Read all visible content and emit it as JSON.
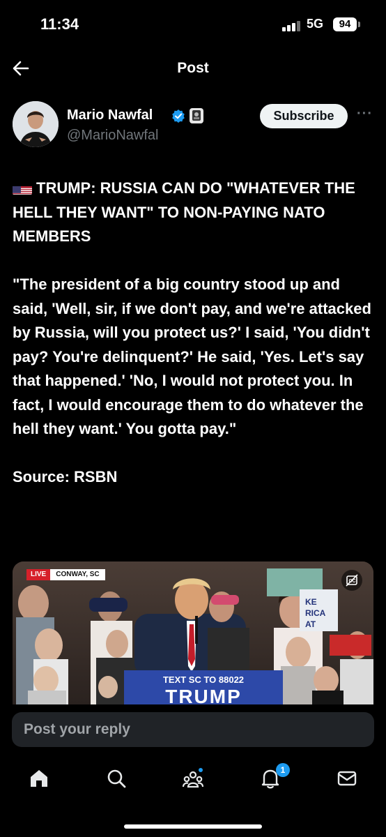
{
  "status_bar": {
    "time": "11:34",
    "network": "5G",
    "battery": "94"
  },
  "header": {
    "title": "Post"
  },
  "author": {
    "name": "Mario Nawfal",
    "handle": "@MarioNawfal"
  },
  "actions": {
    "subscribe_label": "Subscribe",
    "more_label": "···"
  },
  "post": {
    "headline": "TRUMP: RUSSIA CAN DO \"WHATEVER THE HELL THEY WANT\" TO NON-PAYING NATO MEMBERS",
    "quote": "\"The president of a big country stood up and said, 'Well, sir, if we don't pay, and we're attacked by Russia, will you protect us?' I said, 'You didn't pay? You're delinquent?' He said, 'Yes. Let's say that happened.' 'No, I would not protect you. In fact, I would encourage them to do whatever the hell they want.' You gotta pay.\"",
    "source": "Source: RSBN"
  },
  "media": {
    "live_label": "LIVE",
    "location": "CONWAY, SC",
    "banner_small": "TEXT SC TO 88022",
    "banner_big": "TRUMP"
  },
  "reply": {
    "placeholder": "Post your reply"
  },
  "nav": {
    "notification_count": "1"
  },
  "colors": {
    "background": "#000000",
    "accent": "#1d9bf0",
    "muted": "#71767b"
  }
}
